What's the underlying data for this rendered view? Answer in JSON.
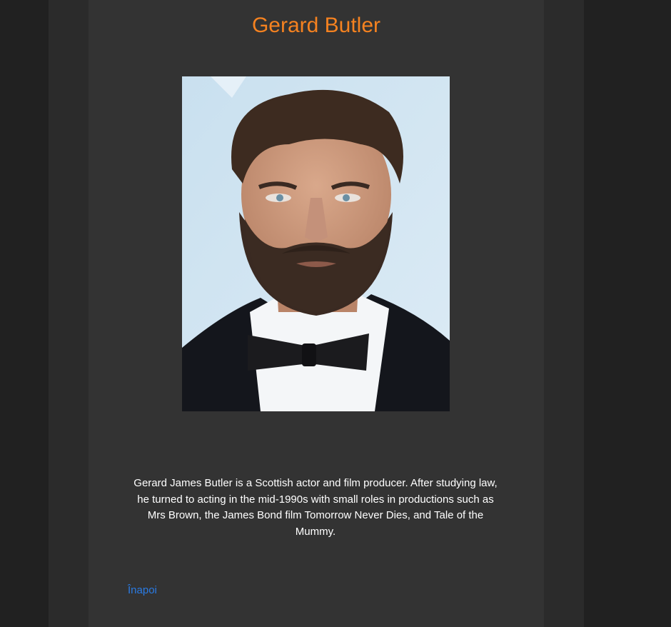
{
  "page": {
    "title": "Gerard Butler",
    "photo_subject": "Gerard Butler",
    "bio": "Gerard James Butler is a Scottish actor and film producer. After studying law, he turned to acting in the mid-1990s with small roles in productions such as Mrs Brown, the James Bond film Tomorrow Never Dies, and Tale of the Mummy.",
    "back_link": "Înapoi"
  },
  "colors": {
    "background": "#212121",
    "outer_column": "#2b2b2b",
    "content_panel": "#333333",
    "title": "#f58220",
    "text": "#ffffff",
    "link": "#2a7be4"
  }
}
